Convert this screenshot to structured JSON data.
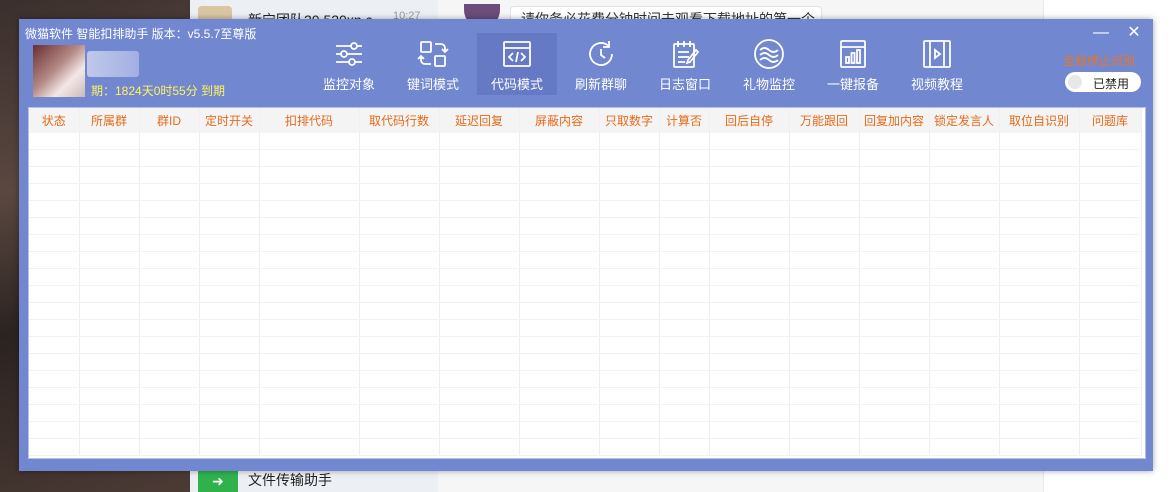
{
  "background": {
    "chat_title": "新宁团队20.520xn.c...",
    "chat_time": "10:27",
    "bubble_text": "请你务必花费分钟时间去观看下载地址的第一个...",
    "bottom_label": "文件传输助手"
  },
  "window": {
    "title": "微猫软件 智能扣排助手 版本：v5.5.7至尊版",
    "min_glyph": "—",
    "close_glyph": "✕"
  },
  "user": {
    "expiry": "期：1824天0时55分 到期"
  },
  "toolbar": {
    "items": [
      {
        "label": "监控对象",
        "icon": "sliders-icon"
      },
      {
        "label": "键词模式",
        "icon": "swap-icon"
      },
      {
        "label": "代码模式",
        "icon": "code-window-icon",
        "active": true
      },
      {
        "label": "刷新群聊",
        "icon": "refresh-icon"
      },
      {
        "label": "日志窗口",
        "icon": "notepad-icon"
      },
      {
        "label": "礼物监控",
        "icon": "waves-icon"
      },
      {
        "label": "一键报备",
        "icon": "bar-chart-icon"
      },
      {
        "label": "视频教程",
        "icon": "video-icon"
      }
    ]
  },
  "controls": {
    "stop_all": "全局停止识别",
    "toggle_label": "已禁用",
    "accent": "#f0741a"
  },
  "table": {
    "columns": [
      "状态",
      "所属群",
      "群ID",
      "定时开关",
      "扣排代码",
      "取代码行数",
      "延迟回复",
      "屏蔽内容",
      "只取数字",
      "计算否",
      "回后自停",
      "万能跟回",
      "回复加内容",
      "锁定发言人",
      "取位自识别",
      "问题库"
    ],
    "header_color": "#e66a1a"
  },
  "colors": {
    "window_bg": "#7187d0",
    "expiry_text": "#fff45a"
  }
}
